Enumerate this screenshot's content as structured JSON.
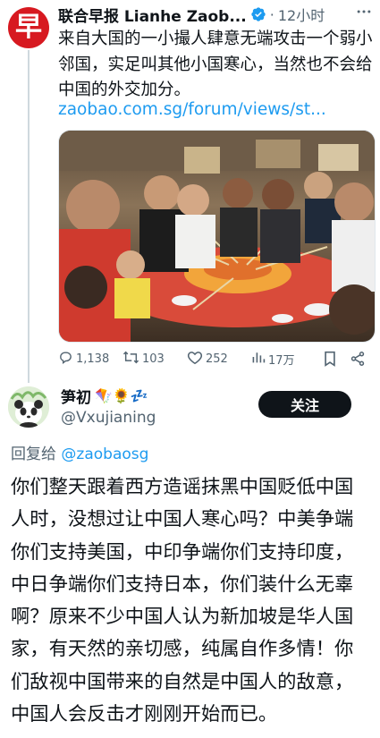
{
  "parent_tweet": {
    "avatar_glyph": "早",
    "author_name": "联合早报 Lianhe Zaob...",
    "separator": "·",
    "time": "12小时",
    "text": "来自大国的一小撮人肆意无端攻击一个弱小邻国，实足叫其他小国寒心，当然也不会给中国的外交加分。",
    "link": "zaobao.com.sg/forum/views/st...",
    "stats": {
      "replies": "1,138",
      "retweets": "103",
      "likes": "252",
      "views": "17万"
    }
  },
  "reply_tweet": {
    "author_name": "笋初",
    "name_emojis": "🪁🌻💤",
    "handle": "@Vxujianing",
    "follow_label": "关注",
    "reply_to_prefix": "回复给",
    "reply_to_handle": "@zaobaosg",
    "text": "你们整天跟着西方造谣抹黑中国贬低中国人时，没想过让中国人寒心吗？中美争端你们支持美国，中印争端你们支持印度，中日争端你们支持日本，你们装什么无辜啊？原来不少中国人认为新加坡是华人国家，有天然的亲切感，纯属自作多情！你们敌视中国带来的自然是中国人的敌意，中国人会反击才刚刚开始而已。"
  },
  "icons": [
    "verified-badge-icon",
    "more-icon",
    "reply-icon",
    "retweet-icon",
    "like-icon",
    "views-icon",
    "bookmark-icon",
    "share-icon"
  ],
  "colors": {
    "accent_blue": "#1d9bf0",
    "zaobao_red": "#d71920",
    "secondary_text": "#536471",
    "follow_button_bg": "#0f1419"
  }
}
